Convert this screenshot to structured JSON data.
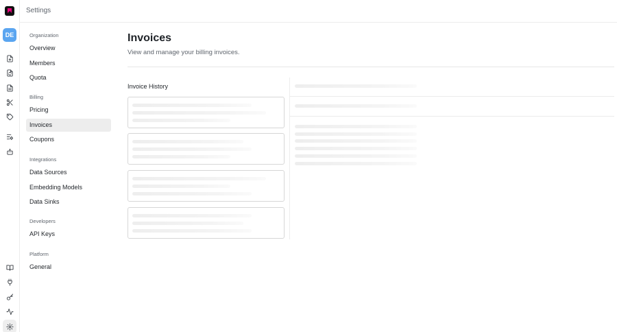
{
  "app": {
    "topbar_title": "Settings",
    "avatar_initials": "DE",
    "brand_accent": "#e6007a",
    "avatar_color": "#5aa5f0"
  },
  "rail": {
    "icons": [
      "document-plus-icon",
      "document-refresh-icon",
      "document-text-icon",
      "scissors-icon",
      "tag-icon",
      "list-settings-icon",
      "robot-icon"
    ],
    "bottom_icons": [
      "book-icon",
      "plug-icon",
      "key-icon",
      "activity-icon",
      "gear-icon"
    ]
  },
  "nav": {
    "sections": [
      {
        "label": "Organization",
        "items": [
          {
            "label": "Overview"
          },
          {
            "label": "Members"
          },
          {
            "label": "Quota"
          }
        ]
      },
      {
        "label": "Billing",
        "items": [
          {
            "label": "Pricing"
          },
          {
            "label": "Invoices",
            "active": true
          },
          {
            "label": "Coupons"
          }
        ]
      },
      {
        "label": "Integrations",
        "items": [
          {
            "label": "Data Sources"
          },
          {
            "label": "Embedding Models"
          },
          {
            "label": "Data Sinks"
          }
        ]
      },
      {
        "label": "Developers",
        "items": [
          {
            "label": "API Keys"
          }
        ]
      },
      {
        "label": "Platform",
        "items": [
          {
            "label": "General"
          }
        ]
      }
    ]
  },
  "main": {
    "title": "Invoices",
    "subtitle": "View and manage your billing invoices.",
    "history_title": "Invoice History"
  }
}
